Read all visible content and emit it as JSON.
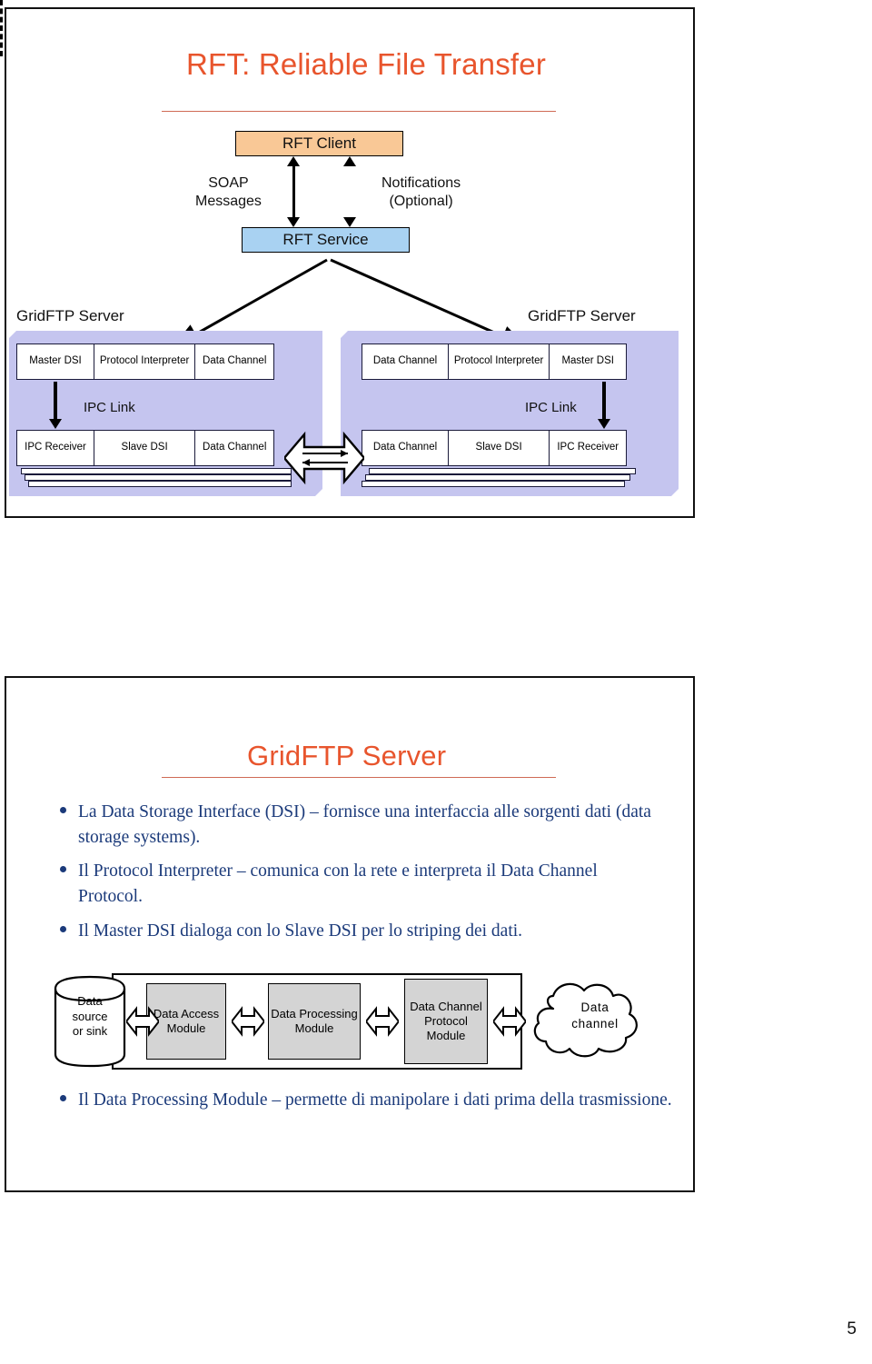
{
  "slides": [
    {
      "title": "RFT: Reliable File Transfer",
      "diagram": {
        "client_box": "RFT Client",
        "service_box": "RFT Service",
        "soap_label": "SOAP\nMessages",
        "soap_label_line1": "SOAP",
        "soap_label_line2": "Messages",
        "notifications_label_line1": "Notifications",
        "notifications_label_line2": "(Optional)",
        "server_left": {
          "caption": "GridFTP Server",
          "ipc_link_label": "IPC Link",
          "top_row": [
            "Master DSI",
            "Protocol Interpreter",
            "Data Channel"
          ],
          "bottom_row": [
            "IPC Receiver",
            "Slave DSI",
            "Data Channel"
          ]
        },
        "server_right": {
          "caption": "GridFTP Server",
          "ipc_link_label": "IPC Link",
          "top_row": [
            "Data Channel",
            "Protocol Interpreter",
            "Master DSI"
          ],
          "bottom_row": [
            "Data Channel",
            "Slave DSI",
            "IPC Receiver"
          ]
        }
      }
    },
    {
      "title": "GridFTP Server",
      "bullets": [
        "La Data Storage Interface (DSI) – fornisce una interfaccia alle sorgenti dati (data storage systems).",
        "Il Protocol Interpreter – comunica con la rete e interpreta il Data Channel Protocol.",
        "Il Master DSI dialoga con lo Slave DSI per lo striping dei dati."
      ],
      "final_bullet": "Il Data Processing Module – permette di manipolare i dati prima della trasmissione.",
      "module_diagram": {
        "source": "Data source or sink",
        "modules": [
          "Data Access Module",
          "Data Processing Module",
          "Data Channel Protocol Module"
        ],
        "sink": "Data channel"
      }
    }
  ],
  "page_number": "5",
  "colors": {
    "title_orange": "#e8552d",
    "bullet_blue": "#1b3a7a",
    "client_orange": "#f9c896",
    "service_blue": "#a9d2f2",
    "panel_purple": "#c5c5ef",
    "module_gray": "#d4d4d4",
    "rule_red": "#cf6b55"
  }
}
